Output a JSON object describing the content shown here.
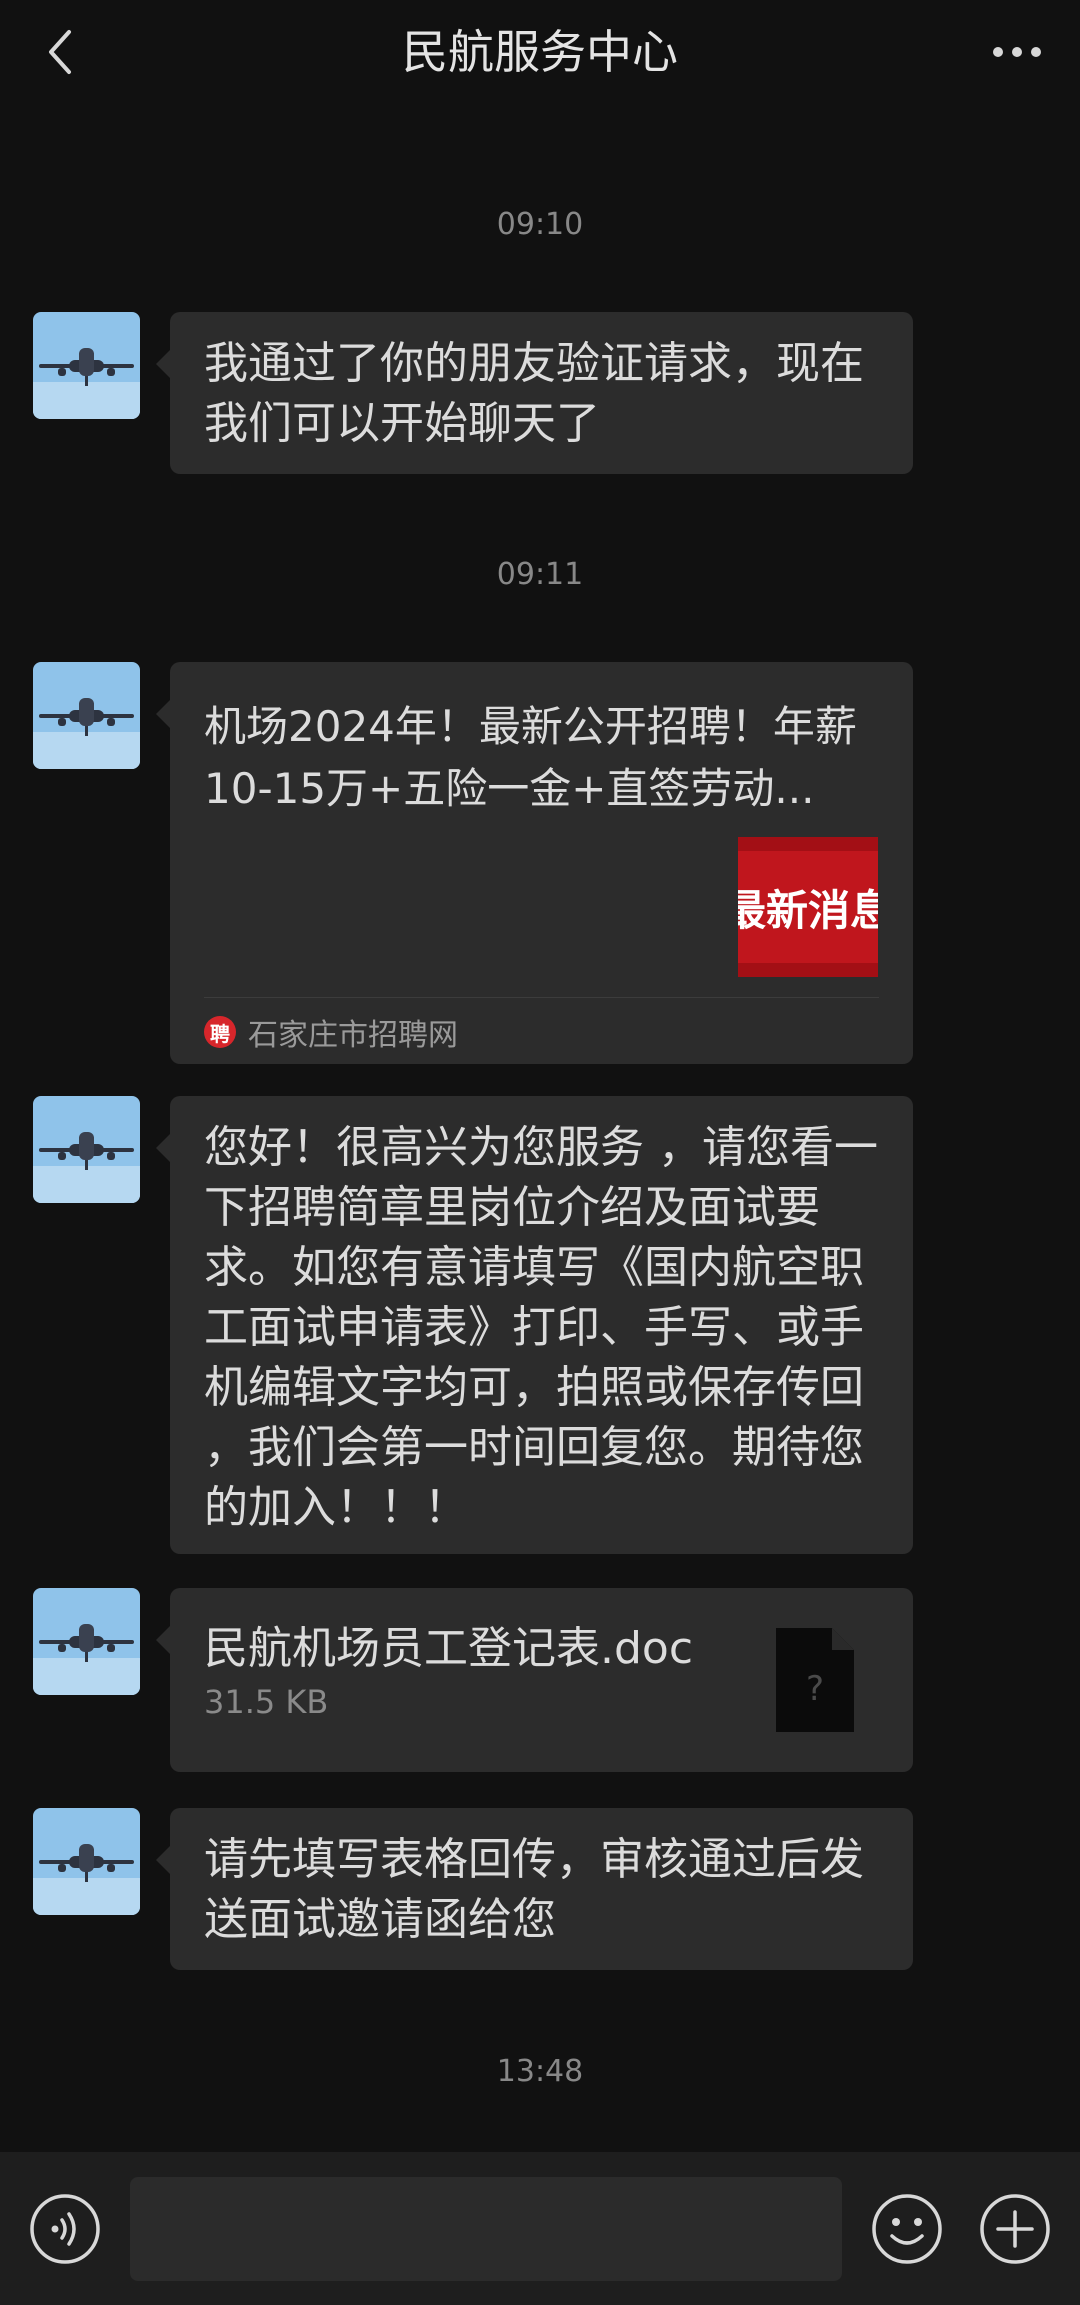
{
  "header": {
    "title": "民航服务中心",
    "back_icon": "chevron-left-icon",
    "more_icon": "more-horizontal-icon"
  },
  "timestamps": [
    "09:10",
    "09:11",
    "13:48"
  ],
  "contact": {
    "avatar_icon": "airplane-avatar",
    "avatar_colors": {
      "sky": "#8fc3ea",
      "plane": "#2d3340"
    }
  },
  "messages": [
    {
      "type": "text",
      "text": "我通过了你的朋友验证请求，现在我们可以开始聊天了"
    },
    {
      "type": "link_card",
      "title": "机场2024年！最新公开招聘！年薪10-15万+五险一金+直签劳动...",
      "thumb_text": "最新消息",
      "source_logo_text": "聘",
      "source": "石家庄市招聘网"
    },
    {
      "type": "text",
      "text": "您好！很高兴为您服务 ，请您看一下招聘简章里岗位介绍及面试要求。如您有意请填写《国内航空职工面试申请表》打印、手写、或手机编辑文字均可，拍照或保存传回 ，我们会第一时间回复您。期待您的加入！！！"
    },
    {
      "type": "file",
      "file_name": "民航机场员工登记表.doc",
      "file_size": "31.5 KB",
      "file_icon": "unknown-file-icon"
    },
    {
      "type": "text",
      "text": "请先填写表格回传，审核通过后发送面试邀请函给您"
    }
  ],
  "input_bar": {
    "voice_icon": "voice-icon",
    "emoji_icon": "emoji-icon",
    "plus_icon": "plus-icon",
    "input_value": ""
  },
  "colors": {
    "background": "#111111",
    "bubble": "#2c2c2c",
    "text": "#dcdcdc",
    "muted": "#888888",
    "card_red": "#c0161d"
  }
}
